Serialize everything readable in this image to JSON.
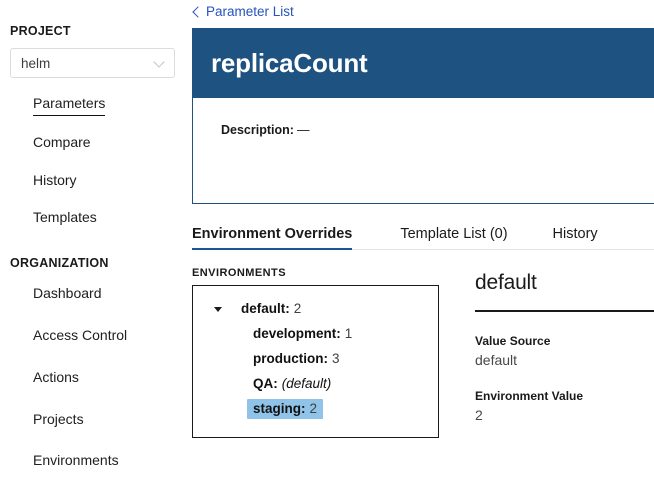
{
  "sidebar": {
    "project_section": {
      "label": "PROJECT",
      "select": {
        "value": "helm",
        "icon": "chevron-down-icon"
      },
      "items": [
        {
          "label": "Parameters",
          "active": true
        },
        {
          "label": "Compare",
          "active": false
        },
        {
          "label": "History",
          "active": false
        },
        {
          "label": "Templates",
          "active": false
        }
      ]
    },
    "organization_section": {
      "label": "ORGANIZATION",
      "items": [
        {
          "label": "Dashboard"
        },
        {
          "label": "Access Control"
        },
        {
          "label": "Actions"
        },
        {
          "label": "Projects"
        },
        {
          "label": "Environments"
        }
      ]
    }
  },
  "main": {
    "breadcrumb": {
      "icon": "chevron-left-icon",
      "label": "Parameter List"
    },
    "parameter_card": {
      "title": "replicaCount",
      "description_label": "Description:",
      "description_value": "—"
    },
    "tabs": [
      {
        "label": "Environment Overrides",
        "active": true
      },
      {
        "label": "Template List (0)",
        "active": false
      },
      {
        "label": "History",
        "active": false
      }
    ],
    "environments": {
      "label": "ENVIRONMENTS",
      "tree": [
        {
          "name": "default",
          "value": "2",
          "level": 0,
          "expanded": true,
          "selected": false,
          "italic": false
        },
        {
          "name": "development",
          "value": "1",
          "level": 1,
          "expanded": false,
          "selected": false,
          "italic": false
        },
        {
          "name": "production",
          "value": "3",
          "level": 1,
          "expanded": false,
          "selected": false,
          "italic": false
        },
        {
          "name": "QA",
          "value": "(default)",
          "level": 1,
          "expanded": false,
          "selected": false,
          "italic": true
        },
        {
          "name": "staging",
          "value": "2",
          "level": 1,
          "expanded": false,
          "selected": true,
          "italic": false
        }
      ]
    },
    "detail": {
      "title": "default",
      "fields": [
        {
          "label": "Value Source",
          "value": "default"
        },
        {
          "label": "Environment Value",
          "value": "2"
        }
      ]
    }
  },
  "colors": {
    "banner": "#1e5280",
    "link": "#2653bd",
    "tab_underline": "#1a5596",
    "selection": "#8fc3e8"
  }
}
